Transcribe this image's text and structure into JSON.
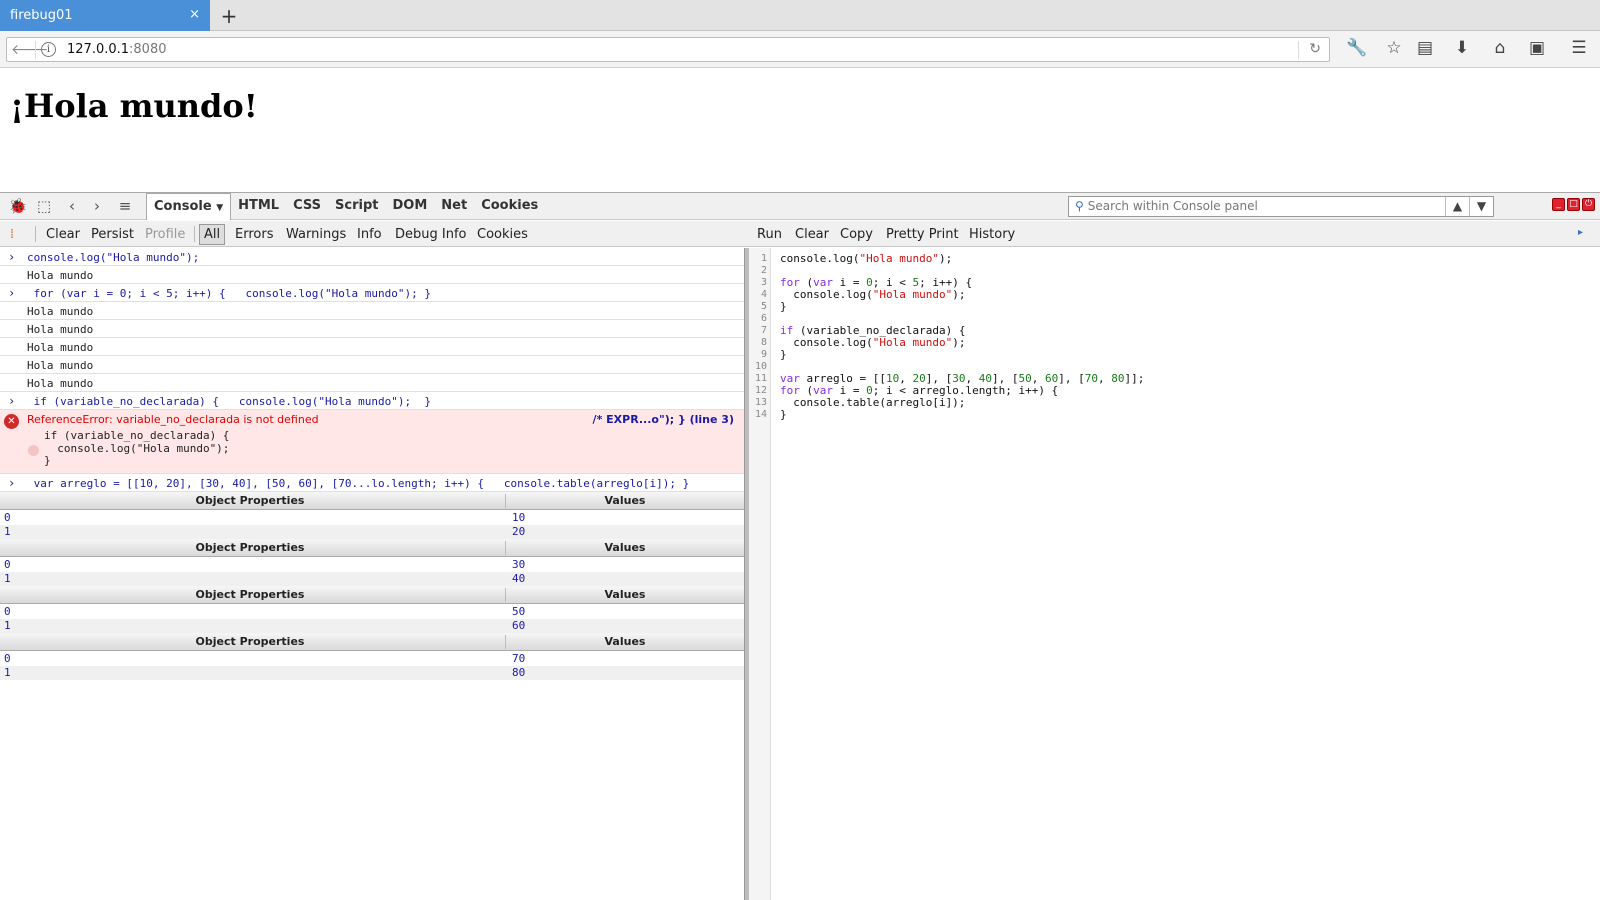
{
  "browser": {
    "tab_title": "firebug01",
    "tab_close": "×",
    "new_tab": "+",
    "url_host": "127.0.0.1",
    "url_port": ":8080"
  },
  "page": {
    "heading": "¡Hola mundo!"
  },
  "firebug": {
    "tabs": [
      "Console",
      "HTML",
      "CSS",
      "Script",
      "DOM",
      "Net",
      "Cookies"
    ],
    "active_tab": "Console",
    "search_placeholder": "Search within Console panel",
    "console_toolbar": {
      "clear": "Clear",
      "persist": "Persist",
      "profile": "Profile",
      "all": "All",
      "errors": "Errors",
      "warnings": "Warnings",
      "info": "Info",
      "debug_info": "Debug Info",
      "cookies": "Cookies"
    },
    "editor_toolbar": {
      "run": "Run",
      "clear": "Clear",
      "copy": "Copy",
      "pretty_print": "Pretty Print",
      "history": "History"
    },
    "log": {
      "cmd1": "console.log(\"Hola mundo\");",
      "out1": "Hola mundo",
      "cmd2": " for (var i = 0; i < 5; i++) {   console.log(\"Hola mundo\"); }",
      "out2": [
        "Hola mundo",
        "Hola mundo",
        "Hola mundo",
        "Hola mundo",
        "Hola mundo"
      ],
      "cmd3": " if (variable_no_declarada) {   console.log(\"Hola mundo\");  }",
      "error_msg": "ReferenceError: variable_no_declarada is not defined",
      "error_loc": "/* EXPR...o\"); } (line 3)",
      "error_code": "if (variable_no_declarada) {\n  console.log(\"Hola mundo\");\n}",
      "cmd4": " var arreglo = [[10, 20], [30, 40], [50, 60], [70...lo.length; i++) {   console.table(arreglo[i]); }",
      "table_header_props": "Object Properties",
      "table_header_values": "Values",
      "tables": [
        {
          "rows": [
            {
              "k": "0",
              "v": "10"
            },
            {
              "k": "1",
              "v": "20"
            }
          ]
        },
        {
          "rows": [
            {
              "k": "0",
              "v": "30"
            },
            {
              "k": "1",
              "v": "40"
            }
          ]
        },
        {
          "rows": [
            {
              "k": "0",
              "v": "50"
            },
            {
              "k": "1",
              "v": "60"
            }
          ]
        },
        {
          "rows": [
            {
              "k": "0",
              "v": "70"
            },
            {
              "k": "1",
              "v": "80"
            }
          ]
        }
      ]
    },
    "line_numbers": "1\n2\n3\n4\n5\n6\n7\n8\n9\n10\n11\n12\n13\n14"
  }
}
